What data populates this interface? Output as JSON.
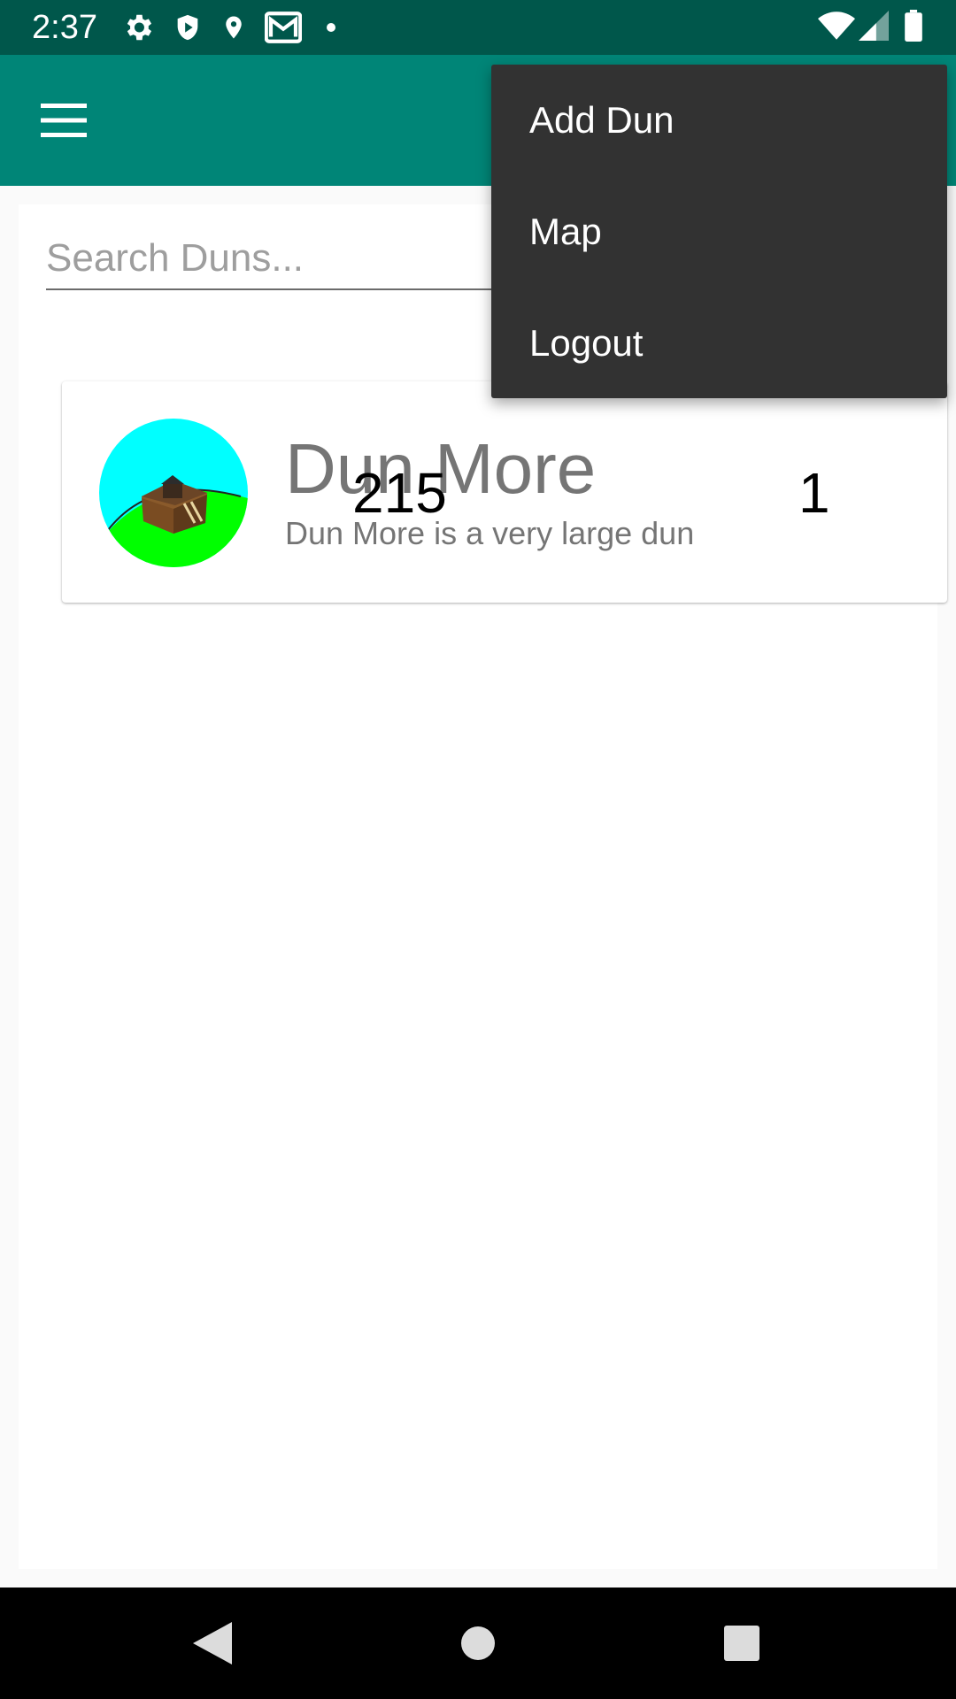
{
  "status_bar": {
    "time": "2:37",
    "left_icons": [
      "gear-icon",
      "shield-icon",
      "location-pin-icon",
      "gmail-icon",
      "dot-icon"
    ],
    "right_icons": [
      "wifi-icon",
      "signal-icon",
      "battery-icon"
    ]
  },
  "app_bar": {
    "color": "#008577",
    "menu_icon": "hamburger-menu-icon"
  },
  "search": {
    "placeholder": "Search Duns...",
    "value": ""
  },
  "duns": [
    {
      "name": "Dun More",
      "description": "Dun More is a very large dun",
      "count_a": "215",
      "count_b": "1",
      "avatar": "fort-on-hill-image"
    }
  ],
  "overflow_menu": {
    "items": [
      {
        "label": "Add Dun"
      },
      {
        "label": "Map"
      },
      {
        "label": "Logout"
      }
    ]
  },
  "nav_bar": {
    "buttons": [
      "back-icon",
      "home-icon",
      "recents-icon"
    ]
  }
}
